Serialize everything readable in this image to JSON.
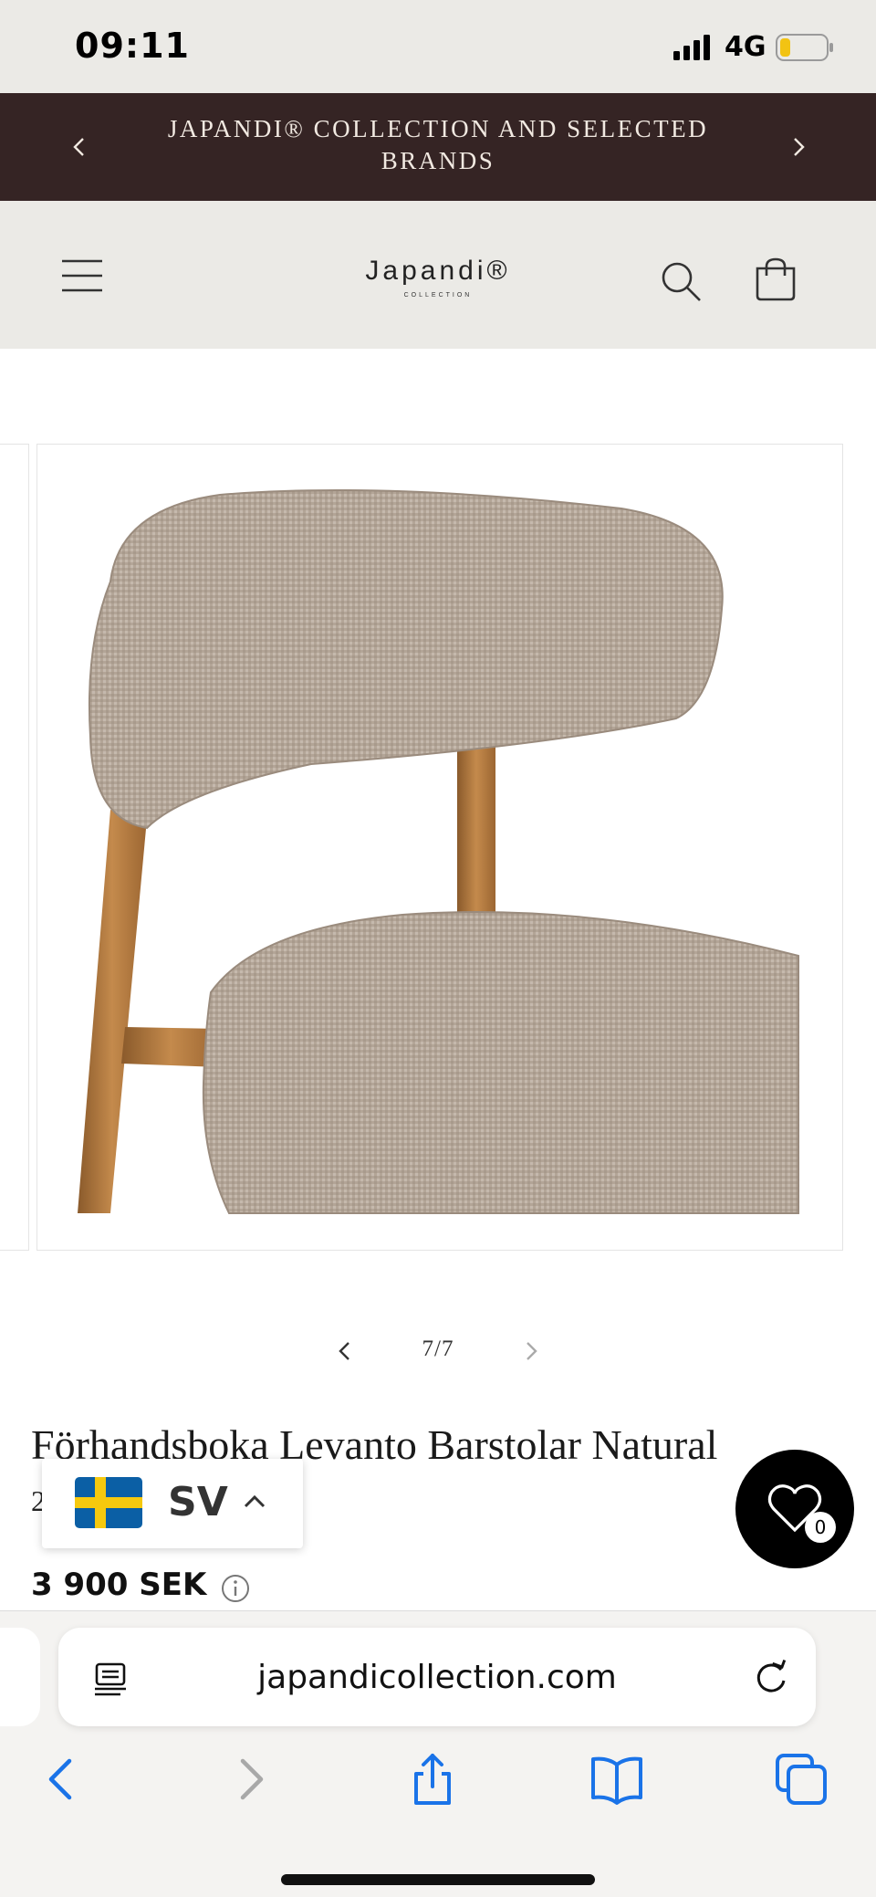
{
  "status_bar": {
    "time": "09:11",
    "network": "4G",
    "icons": [
      "signal-icon",
      "battery-icon"
    ]
  },
  "announcement": {
    "text": "JAPANDI® COLLECTION AND SELECTED BRANDS",
    "prev_icon": "chevron-left-icon",
    "next_icon": "chevron-right-icon"
  },
  "header": {
    "logo_main": "Japandi®",
    "logo_sub": "COLLECTION",
    "icons": [
      "hamburger-menu-icon",
      "search-icon",
      "shopping-bag-icon"
    ]
  },
  "gallery": {
    "counter": "7/7",
    "image_description": "Close-up of upholstered bar stool with beige textured fabric seat and backrest on natural wood frame"
  },
  "product": {
    "title": "Förhandsboka Levanto Barstolar Natural",
    "subtitle": "2",
    "price": "3 900 SEK"
  },
  "language_picker": {
    "code": "SV",
    "flag": "sweden-flag-icon"
  },
  "wishlist": {
    "count": "0"
  },
  "browser": {
    "url": "japandicollection.com",
    "toolbar": [
      "back-icon",
      "forward-icon",
      "share-icon",
      "bookmarks-icon",
      "tabs-icon"
    ]
  },
  "colors": {
    "announcement_bg": "#352424",
    "header_bg": "#ebeae6",
    "accent_blue": "#1a73e8",
    "sweden_blue": "#0b5fa5",
    "sweden_yellow": "#f6c90e"
  }
}
